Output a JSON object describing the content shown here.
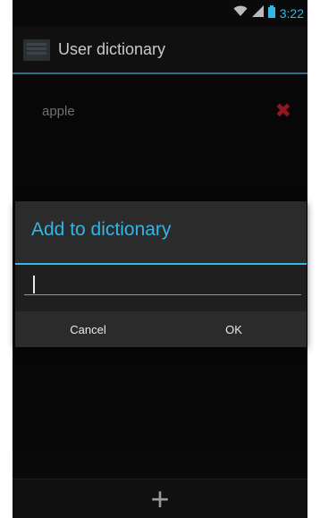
{
  "status_bar": {
    "time": "3:22",
    "icons": [
      "wifi-icon",
      "signal-icon",
      "battery-icon"
    ]
  },
  "action_bar": {
    "title": "User dictionary",
    "icon": "dictionary-app-icon"
  },
  "dictionary": {
    "words": [
      {
        "word": "apple",
        "delete_icon": "delete-icon"
      }
    ]
  },
  "dialog": {
    "title": "Add to dictionary",
    "input_value": "",
    "cancel_label": "Cancel",
    "ok_label": "OK"
  },
  "bottom_bar": {
    "add_icon": "add-icon"
  },
  "colors": {
    "accent": "#33b5e5",
    "delete": "#cc1f2a",
    "background": "#0a0a0a",
    "dialog": "#2b2b2b"
  }
}
